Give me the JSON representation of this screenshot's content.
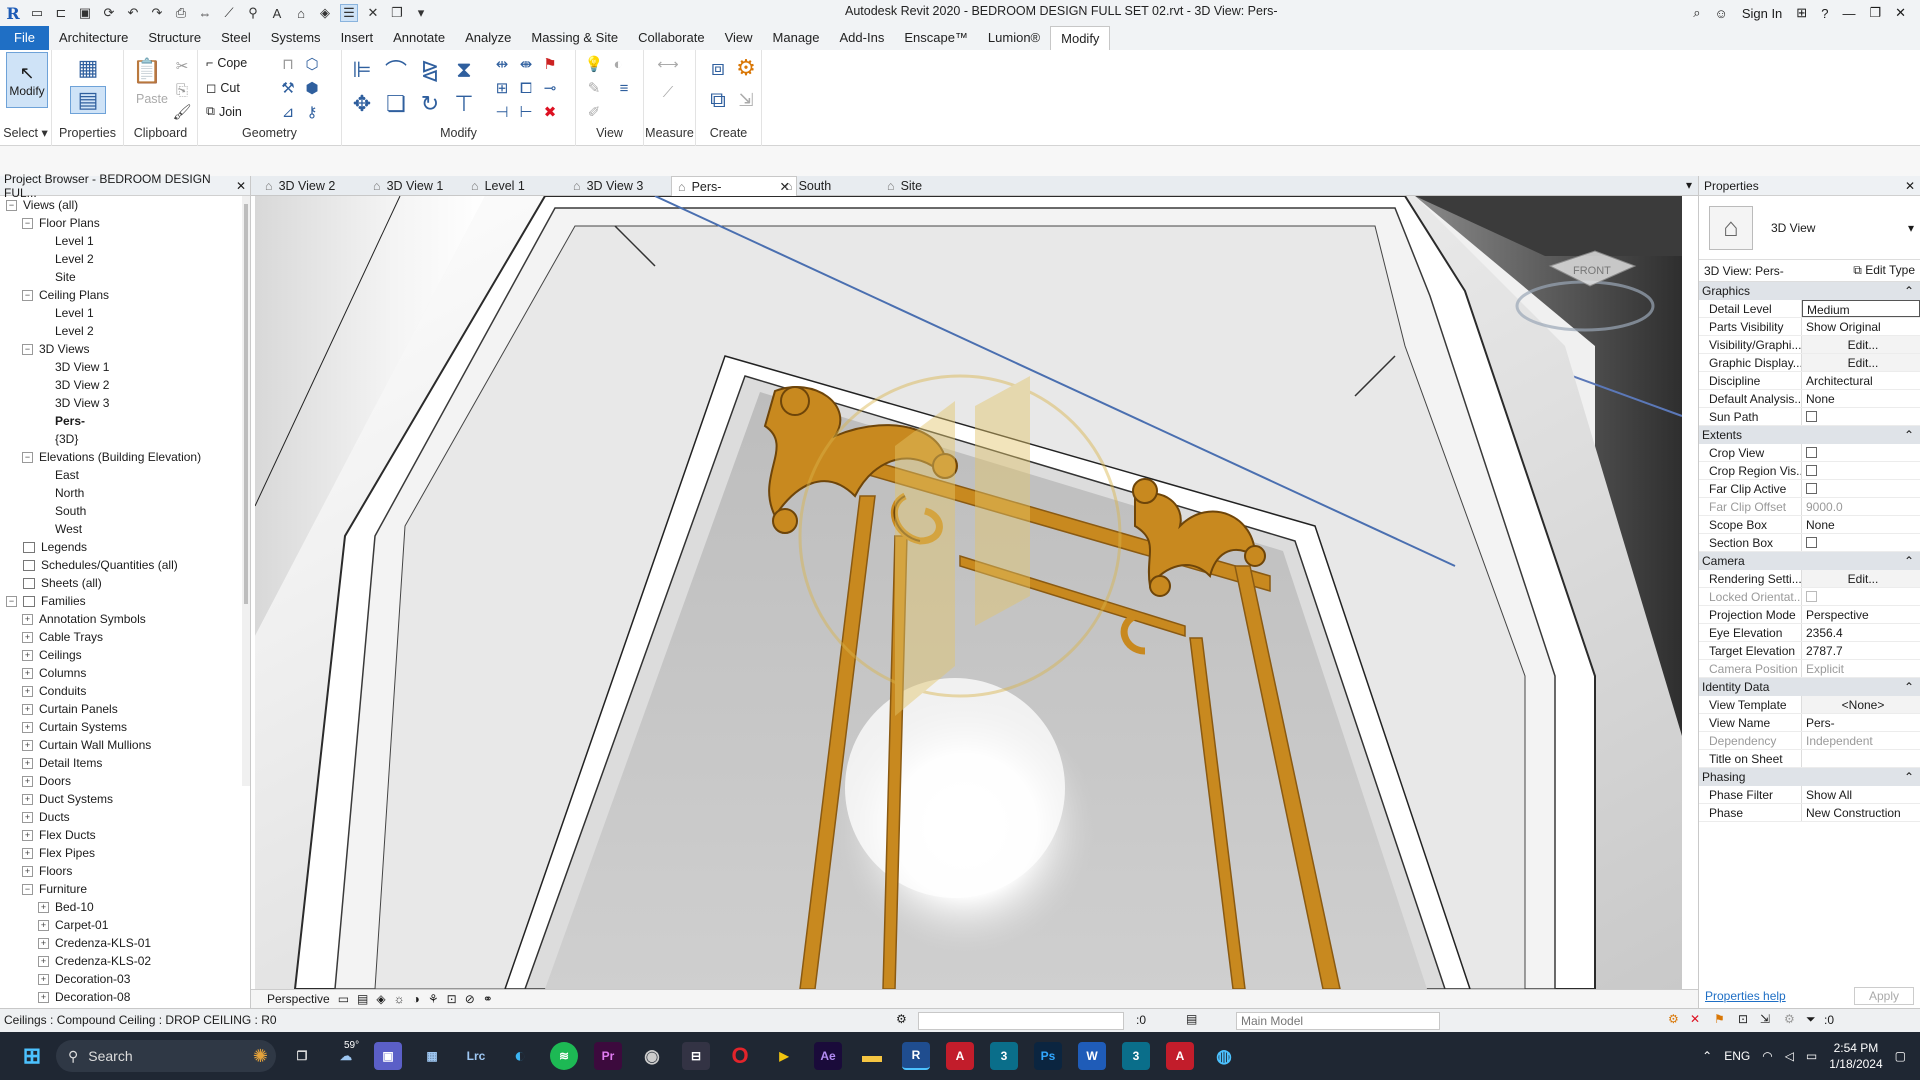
{
  "window": {
    "title": "Autodesk Revit 2020 - BEDROOM DESIGN FULL SET 02.rvt - 3D View: Pers-",
    "sign_in": "Sign In"
  },
  "menu": [
    "File",
    "Architecture",
    "Structure",
    "Steel",
    "Systems",
    "Insert",
    "Annotate",
    "Analyze",
    "Massing & Site",
    "Collaborate",
    "View",
    "Manage",
    "Add-Ins",
    "Enscape™",
    "Lumion®",
    "Modify"
  ],
  "ribbon": {
    "select": {
      "button": "Modify",
      "label": "Select ▾"
    },
    "properties": {
      "label": "Properties"
    },
    "clipboard": {
      "paste": "Paste",
      "label": "Clipboard"
    },
    "geometry": {
      "cope": "Cope",
      "cut": "Cut",
      "join": "Join",
      "label": "Geometry"
    },
    "modify": {
      "label": "Modify"
    },
    "view": {
      "label": "View"
    },
    "measure": {
      "label": "Measure"
    },
    "create": {
      "label": "Create"
    }
  },
  "project_browser": {
    "title": "Project Browser - BEDROOM DESIGN FUL...",
    "items": [
      {
        "label": "Views (all)",
        "indent": 0,
        "toggle": "−",
        "bold": false
      },
      {
        "label": "Floor Plans",
        "indent": 1,
        "toggle": "−",
        "bold": false
      },
      {
        "label": "Level 1",
        "indent": 2,
        "toggle": "",
        "bold": false
      },
      {
        "label": "Level 2",
        "indent": 2,
        "toggle": "",
        "bold": false
      },
      {
        "label": "Site",
        "indent": 2,
        "toggle": "",
        "bold": false
      },
      {
        "label": "Ceiling Plans",
        "indent": 1,
        "toggle": "−",
        "bold": false
      },
      {
        "label": "Level 1",
        "indent": 2,
        "toggle": "",
        "bold": false
      },
      {
        "label": "Level 2",
        "indent": 2,
        "toggle": "",
        "bold": false
      },
      {
        "label": "3D Views",
        "indent": 1,
        "toggle": "−",
        "bold": false
      },
      {
        "label": "3D View 1",
        "indent": 2,
        "toggle": "",
        "bold": false
      },
      {
        "label": "3D View 2",
        "indent": 2,
        "toggle": "",
        "bold": false
      },
      {
        "label": "3D View 3",
        "indent": 2,
        "toggle": "",
        "bold": false
      },
      {
        "label": "Pers-",
        "indent": 2,
        "toggle": "",
        "bold": true
      },
      {
        "label": "{3D}",
        "indent": 2,
        "toggle": "",
        "bold": false
      },
      {
        "label": "Elevations (Building Elevation)",
        "indent": 1,
        "toggle": "−",
        "bold": false
      },
      {
        "label": "East",
        "indent": 2,
        "toggle": "",
        "bold": false
      },
      {
        "label": "North",
        "indent": 2,
        "toggle": "",
        "bold": false
      },
      {
        "label": "South",
        "indent": 2,
        "toggle": "",
        "bold": false
      },
      {
        "label": "West",
        "indent": 2,
        "toggle": "",
        "bold": false
      },
      {
        "label": "Legends",
        "indent": 0,
        "toggle": "",
        "bold": false,
        "icon": true
      },
      {
        "label": "Schedules/Quantities (all)",
        "indent": 0,
        "toggle": "",
        "bold": false,
        "icon": true
      },
      {
        "label": "Sheets (all)",
        "indent": 0,
        "toggle": "",
        "bold": false,
        "icon": true
      },
      {
        "label": "Families",
        "indent": 0,
        "toggle": "−",
        "bold": false,
        "icon": true
      },
      {
        "label": "Annotation Symbols",
        "indent": 1,
        "toggle": "+",
        "bold": false
      },
      {
        "label": "Cable Trays",
        "indent": 1,
        "toggle": "+",
        "bold": false
      },
      {
        "label": "Ceilings",
        "indent": 1,
        "toggle": "+",
        "bold": false
      },
      {
        "label": "Columns",
        "indent": 1,
        "toggle": "+",
        "bold": false
      },
      {
        "label": "Conduits",
        "indent": 1,
        "toggle": "+",
        "bold": false
      },
      {
        "label": "Curtain Panels",
        "indent": 1,
        "toggle": "+",
        "bold": false
      },
      {
        "label": "Curtain Systems",
        "indent": 1,
        "toggle": "+",
        "bold": false
      },
      {
        "label": "Curtain Wall Mullions",
        "indent": 1,
        "toggle": "+",
        "bold": false
      },
      {
        "label": "Detail Items",
        "indent": 1,
        "toggle": "+",
        "bold": false
      },
      {
        "label": "Doors",
        "indent": 1,
        "toggle": "+",
        "bold": false
      },
      {
        "label": "Duct Systems",
        "indent": 1,
        "toggle": "+",
        "bold": false
      },
      {
        "label": "Ducts",
        "indent": 1,
        "toggle": "+",
        "bold": false
      },
      {
        "label": "Flex Ducts",
        "indent": 1,
        "toggle": "+",
        "bold": false
      },
      {
        "label": "Flex Pipes",
        "indent": 1,
        "toggle": "+",
        "bold": false
      },
      {
        "label": "Floors",
        "indent": 1,
        "toggle": "+",
        "bold": false
      },
      {
        "label": "Furniture",
        "indent": 1,
        "toggle": "−",
        "bold": false
      },
      {
        "label": "Bed-10",
        "indent": 2,
        "toggle": "+",
        "bold": false
      },
      {
        "label": "Carpet-01",
        "indent": 2,
        "toggle": "+",
        "bold": false
      },
      {
        "label": "Credenza-KLS-01",
        "indent": 2,
        "toggle": "+",
        "bold": false
      },
      {
        "label": "Credenza-KLS-02",
        "indent": 2,
        "toggle": "+",
        "bold": false
      },
      {
        "label": "Decoration-03",
        "indent": 2,
        "toggle": "+",
        "bold": false
      },
      {
        "label": "Decoration-08",
        "indent": 2,
        "toggle": "+",
        "bold": false
      }
    ]
  },
  "view_tabs": [
    {
      "label": "3D View 2",
      "active": false
    },
    {
      "label": "3D View 1",
      "active": false
    },
    {
      "label": "Level 1",
      "active": false
    },
    {
      "label": "3D View 3",
      "active": false
    },
    {
      "label": "Pers-",
      "active": true
    },
    {
      "label": "South",
      "active": false
    },
    {
      "label": "Site",
      "active": false
    }
  ],
  "view": {
    "mode": "Perspective",
    "viewcube": "FRONT"
  },
  "properties": {
    "title": "Properties",
    "type": "3D View",
    "selector": "3D View: Pers-",
    "edit_type": "Edit Type",
    "groups": [
      {
        "name": "Graphics",
        "rows": [
          {
            "k": "Detail Level",
            "v": "Medium",
            "kind": "text"
          },
          {
            "k": "Parts Visibility",
            "v": "Show Original",
            "kind": "text"
          },
          {
            "k": "Visibility/Graphi...",
            "v": "Edit...",
            "kind": "btn"
          },
          {
            "k": "Graphic Display...",
            "v": "Edit...",
            "kind": "btn"
          },
          {
            "k": "Discipline",
            "v": "Architectural",
            "kind": "text"
          },
          {
            "k": "Default Analysis...",
            "v": "None",
            "kind": "text"
          },
          {
            "k": "Sun Path",
            "v": "",
            "kind": "check"
          }
        ]
      },
      {
        "name": "Extents",
        "rows": [
          {
            "k": "Crop View",
            "v": "",
            "kind": "check"
          },
          {
            "k": "Crop Region Vis...",
            "v": "",
            "kind": "check"
          },
          {
            "k": "Far Clip Active",
            "v": "",
            "kind": "check"
          },
          {
            "k": "Far Clip Offset",
            "v": "9000.0",
            "kind": "dim"
          },
          {
            "k": "Scope Box",
            "v": "None",
            "kind": "text"
          },
          {
            "k": "Section Box",
            "v": "",
            "kind": "check"
          }
        ]
      },
      {
        "name": "Camera",
        "rows": [
          {
            "k": "Rendering Setti...",
            "v": "Edit...",
            "kind": "btn"
          },
          {
            "k": "Locked Orientat...",
            "v": "",
            "kind": "dimcheck"
          },
          {
            "k": "Projection Mode",
            "v": "Perspective",
            "kind": "text"
          },
          {
            "k": "Eye Elevation",
            "v": "2356.4",
            "kind": "text"
          },
          {
            "k": "Target Elevation",
            "v": "2787.7",
            "kind": "text"
          },
          {
            "k": "Camera Position",
            "v": "Explicit",
            "kind": "dim"
          }
        ]
      },
      {
        "name": "Identity Data",
        "rows": [
          {
            "k": "View Template",
            "v": "<None>",
            "kind": "btn"
          },
          {
            "k": "View Name",
            "v": "Pers-",
            "kind": "text"
          },
          {
            "k": "Dependency",
            "v": "Independent",
            "kind": "dim"
          },
          {
            "k": "Title on Sheet",
            "v": "",
            "kind": "text"
          }
        ]
      },
      {
        "name": "Phasing",
        "rows": [
          {
            "k": "Phase Filter",
            "v": "Show All",
            "kind": "text"
          },
          {
            "k": "Phase",
            "v": "New Construction",
            "kind": "text"
          }
        ]
      }
    ],
    "help": "Properties help",
    "apply": "Apply"
  },
  "status": {
    "text": "Ceilings : Compound Ceiling : DROP CEILING : R0",
    "counter": ":0",
    "model": "Main Model",
    "filter_count": ":0"
  },
  "taskbar": {
    "search": "Search",
    "weather": "59°",
    "lang": "ENG",
    "time": "2:54 PM",
    "date": "1/18/2024"
  },
  "colors": {
    "accent": "#1f6fc5",
    "gold": "#c8891f"
  }
}
